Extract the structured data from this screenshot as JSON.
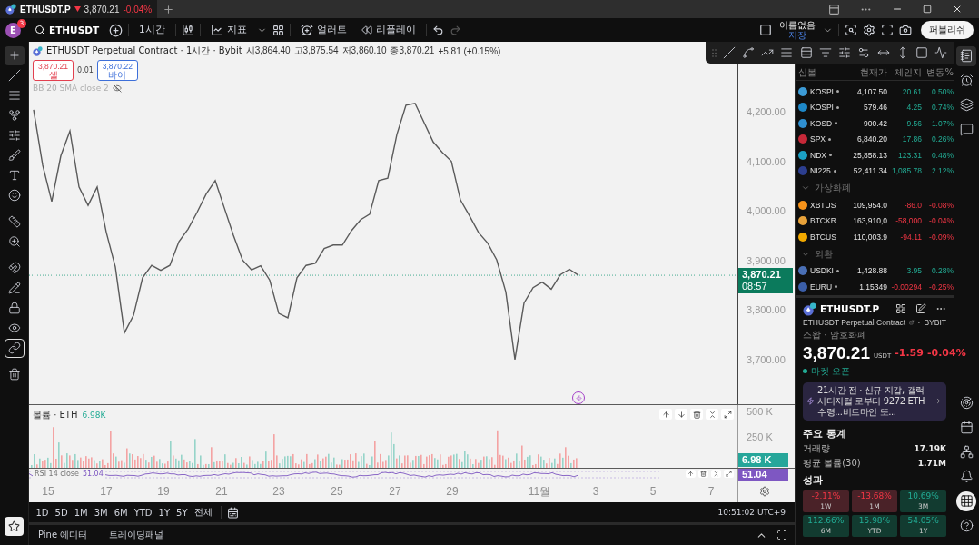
{
  "titlebar": {
    "tab": {
      "symbol": "ETHUSDT.P",
      "rising": false,
      "price": "3,870.21",
      "change": "-0.04%"
    }
  },
  "toolbar": {
    "avatar": "E",
    "notifications": "3",
    "symbol": "ETHUSDT",
    "interval": "1시간",
    "indicators": "지표",
    "alerts": "얼러트",
    "replay": "리플레이",
    "redo_disabled": true,
    "layout_name": "이름없음",
    "save_status": "저장",
    "publish": "퍼블리쉬"
  },
  "left_tools": [
    {
      "selected": true,
      "on": false
    },
    {
      "selected": false,
      "on": false
    },
    {
      "selected": false,
      "on": false
    },
    {
      "selected": false,
      "on": false
    },
    {
      "selected": false,
      "on": false
    },
    {
      "selected": false,
      "on": false
    },
    {
      "selected": false,
      "on": false
    },
    {
      "selected": false,
      "on": false
    },
    {
      "selected": false,
      "on": false
    },
    {
      "selected": false,
      "on": false
    },
    {
      "selected": false,
      "on": false
    },
    {
      "selected": false,
      "on": false
    },
    {
      "selected": false,
      "on": false
    },
    {
      "selected": false,
      "on": false
    },
    {
      "selected": false,
      "on": true
    },
    {
      "selected": false,
      "on": false
    }
  ],
  "chart": {
    "title": "ETHUSDT Perpetual Contract · 1시간 · Bybit",
    "ohlc": [
      {
        "label": "시",
        "value": "3,864.40"
      },
      {
        "label": "고",
        "value": "3,875.54"
      },
      {
        "label": "저",
        "value": "3,860.10"
      },
      {
        "label": "종",
        "value": "3,870.21"
      }
    ],
    "change": "+5.81 (+0.15%)",
    "sell": {
      "price": "3,870.21",
      "label": "셀"
    },
    "spread": "0.01",
    "buy": {
      "price": "3,870.22",
      "label": "바이"
    },
    "indicator": {
      "name": "BB 20 SMA close 2",
      "hidden": true
    },
    "last_price": {
      "price": "3,870.21",
      "countdown": "08:57"
    },
    "chart_data": {
      "type": "line",
      "categories": [
        null,
        null,
        null,
        null,
        null,
        null,
        null,
        null,
        null,
        null,
        null,
        null,
        null,
        null,
        null,
        null,
        null,
        null,
        null,
        null,
        null,
        null,
        null,
        null,
        null,
        null,
        null,
        null,
        null,
        null,
        null,
        null,
        null,
        null,
        null,
        null,
        null,
        null,
        null,
        null,
        null,
        null,
        null,
        null,
        null,
        null,
        null,
        null,
        null,
        null,
        null,
        null,
        null,
        null,
        null,
        null,
        null,
        null,
        null,
        null,
        null,
        null,
        null,
        null,
        null,
        null,
        null,
        null,
        null,
        null,
        null,
        null,
        null,
        null,
        null,
        null,
        null,
        null
      ],
      "series": [
        {
          "color": "#5a5a5a",
          "values": [
            4204,
            4092,
            4019,
            4111,
            4161,
            4048,
            4011,
            4048,
            3957,
            3887,
            3754,
            3789,
            3865,
            3890,
            3880,
            3890,
            3938,
            3963,
            3997,
            4034,
            4061,
            4006,
            3951,
            3901,
            3881,
            3889,
            3860,
            3793,
            3784,
            3865,
            3890,
            3894,
            3924,
            3931,
            3931,
            3960,
            3982,
            3993,
            4061,
            4066,
            4154,
            4213,
            4217,
            4178,
            4139,
            4118,
            4100,
            4022,
            3990,
            3956,
            3935,
            3901,
            3836,
            3700,
            3814,
            3845,
            3856,
            3842,
            3871,
            3882,
            3870,
            null,
            null,
            null,
            null,
            null,
            null,
            null,
            null,
            null,
            null,
            null,
            null,
            null,
            null,
            null,
            null,
            null
          ]
        }
      ],
      "ref_lines": [
        {
          "axis": "y",
          "value": 3870,
          "color": "#1a9a78"
        }
      ],
      "ylim": [
        3610,
        4341
      ],
      "yticks": [
        {
          "value": 4200,
          "label": "4,200.00"
        },
        {
          "value": 4100,
          "label": "4,100.00"
        },
        {
          "value": 4000,
          "label": "4,000.00"
        },
        {
          "value": 3900,
          "label": "3,900.00"
        },
        {
          "value": 3800,
          "label": "3,800.00"
        },
        {
          "value": 3700,
          "label": "3,700.00"
        }
      ]
    },
    "time_axis": [
      "15",
      "17",
      "19",
      "21",
      "23",
      "25",
      "27",
      "29",
      "11월",
      "3",
      "5",
      "7"
    ],
    "volume": {
      "label": "볼륨 · ETH",
      "value": "6.98K",
      "ticks": [
        "500 K",
        "250 K"
      ],
      "tag": "6.98 K"
    },
    "rsi": {
      "label": "RSI 14 close",
      "value": "51.04",
      "tag": "51.04"
    }
  },
  "range_buttons": [
    "1D",
    "5D",
    "1M",
    "3M",
    "6M",
    "YTD",
    "1Y",
    "5Y",
    "전체"
  ],
  "clock": "10:51:02 UTC+9",
  "bottom_tabs": [
    "Pine 에디터",
    "트레이딩패널"
  ],
  "watchlist": {
    "columns": [
      "심볼",
      "현재가",
      "체인지",
      "변동%"
    ],
    "rows": [
      {
        "symbol": "KOSPI",
        "dot": true,
        "price": "4,107.50",
        "change": "20.61",
        "change_pct": "0.50%",
        "rising": true,
        "color": "#3c9bd6"
      },
      {
        "symbol": "KOSPI",
        "dot": true,
        "price": "579.46",
        "change": "4.25",
        "change_pct": "0.74%",
        "rising": true,
        "color": "#1e88c8"
      },
      {
        "symbol": "KOSD",
        "dot": true,
        "price": "900.42",
        "change": "9.56",
        "change_pct": "1.07%",
        "rising": true,
        "color": "#2f8fd0"
      },
      {
        "symbol": "SPX",
        "dot": true,
        "price": "6,840.20",
        "change": "17.86",
        "change_pct": "0.26%",
        "rising": true,
        "color": "#c62838"
      },
      {
        "symbol": "NDX",
        "dot": true,
        "price": "25,858.13",
        "change": "123.31",
        "change_pct": "0.48%",
        "rising": true,
        "color": "#1ba0c4"
      },
      {
        "symbol": "NI225",
        "dot": true,
        "price": "52,411.34",
        "change": "1,085.78",
        "change_pct": "2.12%",
        "rising": true,
        "color": "#2c3e8f"
      }
    ],
    "sections": [
      {
        "title": "가상화폐",
        "expanded": true,
        "rows": [
          {
            "symbol": "XBTUS",
            "dot": false,
            "price": "109,954.0",
            "change": "-86.0",
            "change_pct": "-0.08%",
            "rising": false,
            "color": "#f7931a"
          },
          {
            "symbol": "BTCKR",
            "dot": false,
            "price": "163,910,0",
            "change": "-58,000",
            "change_pct": "-0.04%",
            "rising": false,
            "color": "#e8a23a"
          },
          {
            "symbol": "BTCUS",
            "dot": false,
            "price": "110,003.9",
            "change": "-94.11",
            "change_pct": "-0.09%",
            "rising": false,
            "color": "#f2a900"
          }
        ]
      },
      {
        "title": "외환",
        "expanded": true,
        "rows": [
          {
            "symbol": "USDKI",
            "dot": true,
            "price": "1,428.88",
            "change": "3.95",
            "change_pct": "0.28%",
            "rising": true,
            "color": "#4a6fb5"
          },
          {
            "symbol": "EURU",
            "dot": true,
            "price": "1.15349",
            "change": "-0.00294",
            "change_pct": "-0.25%",
            "rising": false,
            "color": "#3b5ea8"
          }
        ]
      }
    ]
  },
  "details": {
    "symbol": "ETHUSDT.P",
    "description": "ETHUSDT Perpetual Contract",
    "separator": "·",
    "exchange": "BYBIT",
    "type": "스왑 · 암호화폐",
    "price": "3,870.21",
    "currency": "USDT",
    "change": "-1.59",
    "change_pct": "-0.04%",
    "rising": false,
    "market_status": "마켓 오픈",
    "market_open": true,
    "news": "21시간 전 · 신규 지갑, 갤럭시디지털 로부터 9272 ETH 수령...비트마인 또...",
    "stats_title": "주요 통계",
    "stats": [
      {
        "label": "거래량",
        "value": "17.19K"
      },
      {
        "label": "평균 볼륨(30)",
        "value": "1.71M"
      }
    ],
    "performance_title": "성과",
    "performance": [
      {
        "value": "-2.11%",
        "period": "1W",
        "rising": false
      },
      {
        "value": "-13.68%",
        "period": "1M",
        "rising": false
      },
      {
        "value": "10.69%",
        "period": "3M",
        "rising": true
      },
      {
        "value": "112.66%",
        "period": "6M",
        "rising": true
      },
      {
        "value": "15.98%",
        "period": "YTD",
        "rising": true
      },
      {
        "value": "54.05%",
        "period": "1Y",
        "rising": true
      }
    ]
  },
  "right_sidebar": [
    {
      "selected": true
    },
    {
      "selected": false
    },
    {
      "selected": false
    },
    {
      "selected": false
    },
    {
      "selected": false
    },
    {
      "selected": false
    },
    {
      "selected": false
    },
    {
      "selected": false
    },
    {
      "selected": true
    },
    {
      "selected": false
    }
  ]
}
